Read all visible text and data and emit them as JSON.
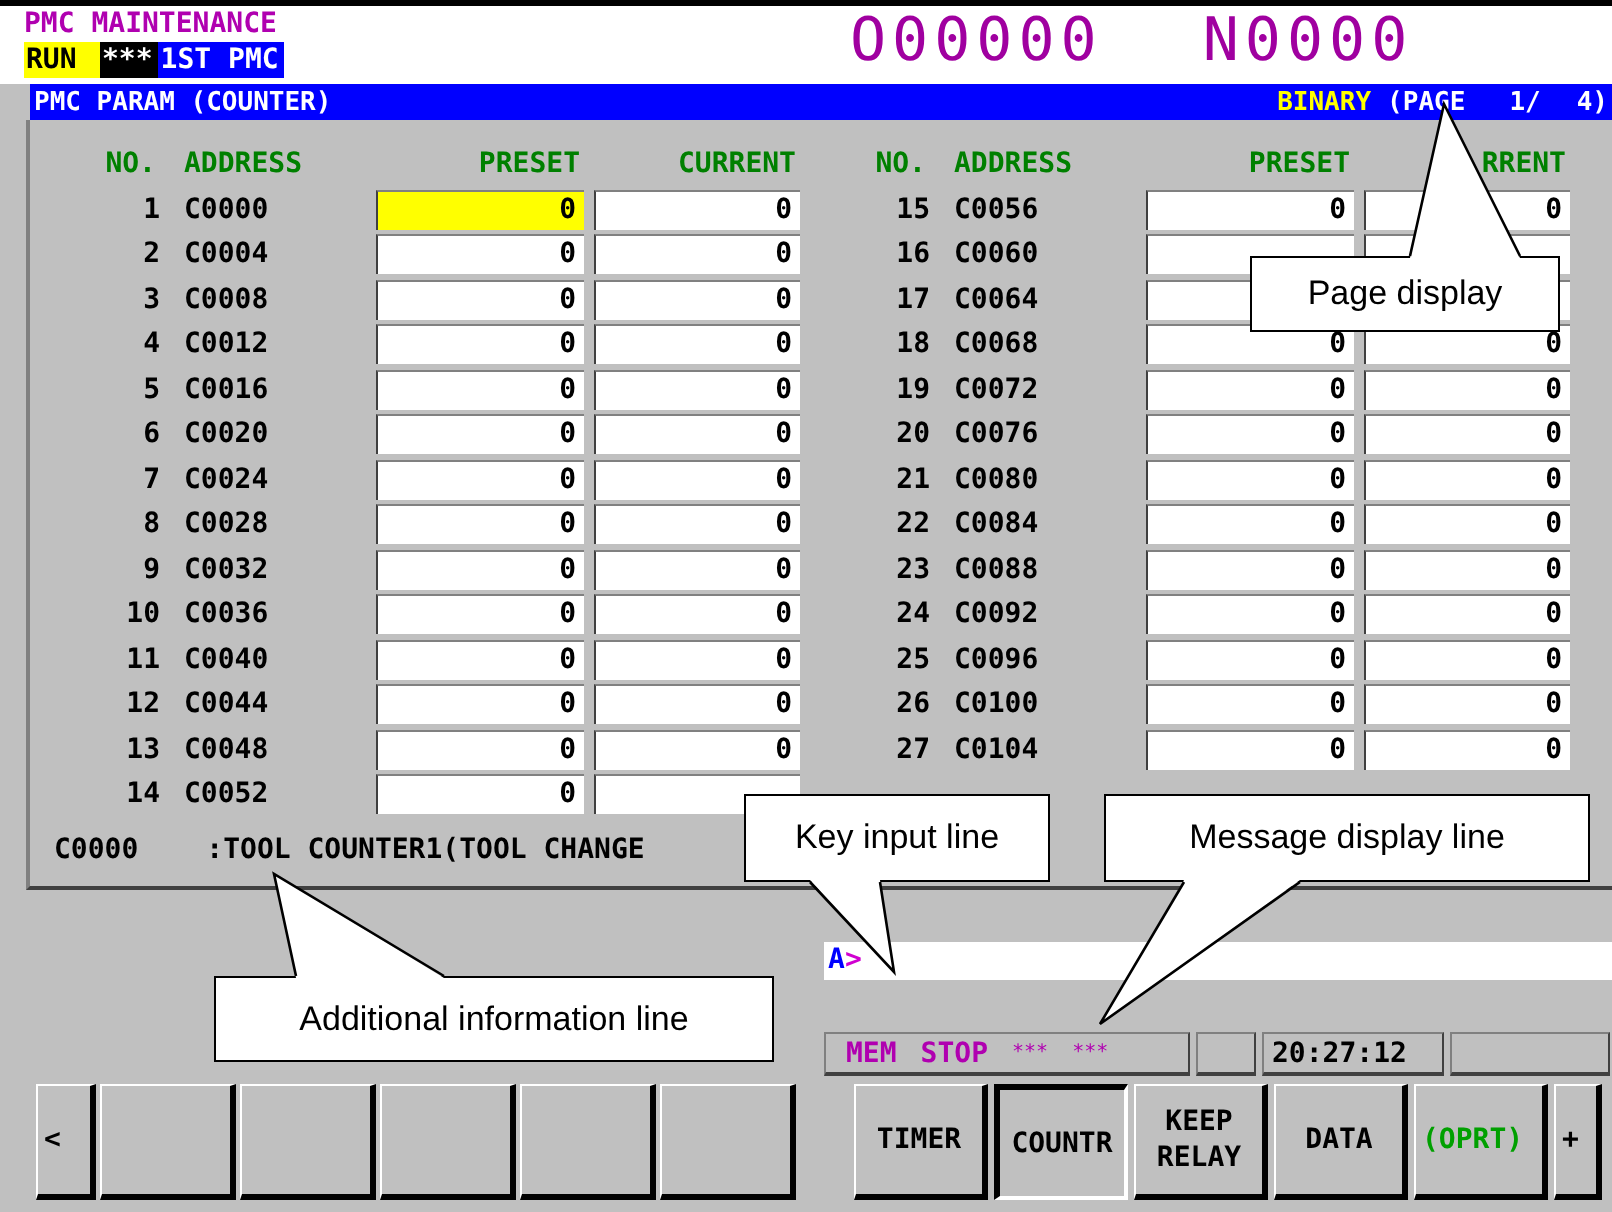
{
  "header": {
    "title": "PMC MAINTENANCE",
    "status": [
      {
        "text": "RUN",
        "kind": "run"
      },
      {
        "text": "***",
        "kind": "alarm"
      },
      {
        "text": "1ST PMC",
        "kind": "pmc"
      }
    ],
    "program_number": "O00000",
    "sequence_number": "N0000"
  },
  "title_bar": {
    "title": "PMC PARAM (COUNTER)",
    "mode": "BINARY",
    "page_label": "(PAGE",
    "page": "1/",
    "page_total": "4)"
  },
  "left_table": {
    "columns": [
      "NO.",
      "ADDRESS",
      "PRESET",
      "CURRENT"
    ],
    "rows": [
      {
        "no": "1",
        "address": "C0000",
        "preset": "0",
        "current": "0",
        "selected": true
      },
      {
        "no": "2",
        "address": "C0004",
        "preset": "0",
        "current": "0",
        "selected": false
      },
      {
        "no": "3",
        "address": "C0008",
        "preset": "0",
        "current": "0",
        "selected": false
      },
      {
        "no": "4",
        "address": "C0012",
        "preset": "0",
        "current": "0",
        "selected": false
      },
      {
        "no": "5",
        "address": "C0016",
        "preset": "0",
        "current": "0",
        "selected": false
      },
      {
        "no": "6",
        "address": "C0020",
        "preset": "0",
        "current": "0",
        "selected": false
      },
      {
        "no": "7",
        "address": "C0024",
        "preset": "0",
        "current": "0",
        "selected": false
      },
      {
        "no": "8",
        "address": "C0028",
        "preset": "0",
        "current": "0",
        "selected": false
      },
      {
        "no": "9",
        "address": "C0032",
        "preset": "0",
        "current": "0",
        "selected": false
      },
      {
        "no": "10",
        "address": "C0036",
        "preset": "0",
        "current": "0",
        "selected": false
      },
      {
        "no": "11",
        "address": "C0040",
        "preset": "0",
        "current": "0",
        "selected": false
      },
      {
        "no": "12",
        "address": "C0044",
        "preset": "0",
        "current": "0",
        "selected": false
      },
      {
        "no": "13",
        "address": "C0048",
        "preset": "0",
        "current": "0",
        "selected": false
      },
      {
        "no": "14",
        "address": "C0052",
        "preset": "0",
        "selected": false
      }
    ]
  },
  "right_table": {
    "columns": [
      "NO.",
      "ADDRESS",
      "PRESET",
      "RRENT"
    ],
    "rows": [
      {
        "no": "15",
        "address": "C0056",
        "preset": "0",
        "current": "0",
        "selected": false
      },
      {
        "no": "16",
        "address": "C0060",
        "selected": false
      },
      {
        "no": "17",
        "address": "C0064",
        "selected": false
      },
      {
        "no": "18",
        "address": "C0068",
        "preset": "0",
        "current": "0",
        "selected": false
      },
      {
        "no": "19",
        "address": "C0072",
        "preset": "0",
        "current": "0",
        "selected": false
      },
      {
        "no": "20",
        "address": "C0076",
        "preset": "0",
        "current": "0",
        "selected": false
      },
      {
        "no": "21",
        "address": "C0080",
        "preset": "0",
        "current": "0",
        "selected": false
      },
      {
        "no": "22",
        "address": "C0084",
        "preset": "0",
        "current": "0",
        "selected": false
      },
      {
        "no": "23",
        "address": "C0088",
        "preset": "0",
        "current": "0",
        "selected": false
      },
      {
        "no": "24",
        "address": "C0092",
        "preset": "0",
        "current": "0",
        "selected": false
      },
      {
        "no": "25",
        "address": "C0096",
        "preset": "0",
        "current": "0",
        "selected": false
      },
      {
        "no": "26",
        "address": "C0100",
        "preset": "0",
        "current": "0",
        "selected": false
      },
      {
        "no": "27",
        "address": "C0104",
        "preset": "0",
        "current": "0",
        "selected": false
      }
    ]
  },
  "info_line": {
    "address": "C0000",
    "text": ":TOOL COUNTER1(TOOL CHANGE"
  },
  "key_input": {
    "prompt": "A",
    "caret": ">"
  },
  "status_bar": {
    "mode": "MEM",
    "state": "STOP",
    "alarm": "***",
    "emergency": "***",
    "time": "20:27:12"
  },
  "left_soft_keys": [
    {
      "label": "<",
      "kind": "prev"
    },
    {
      "kind": "blank"
    },
    {
      "kind": "blank"
    },
    {
      "kind": "blank"
    },
    {
      "kind": "blank"
    },
    {
      "kind": "blank"
    }
  ],
  "right_soft_keys": [
    {
      "label": "TIMER",
      "kind": "menu",
      "selected": false
    },
    {
      "label": "COUNTR",
      "kind": "menu",
      "selected": true
    },
    {
      "label": "KEEP RELAY",
      "kind": "menu",
      "selected": false
    },
    {
      "label": "DATA",
      "kind": "menu",
      "selected": false
    },
    {
      "label": "(OPRT)",
      "kind": "operation",
      "selected": false
    },
    {
      "label": "+",
      "kind": "next",
      "selected": false
    }
  ],
  "callouts": [
    {
      "text": "Page display"
    },
    {
      "text": "Key input line"
    },
    {
      "text": "Message display line"
    },
    {
      "text": "Additional information line"
    }
  ]
}
